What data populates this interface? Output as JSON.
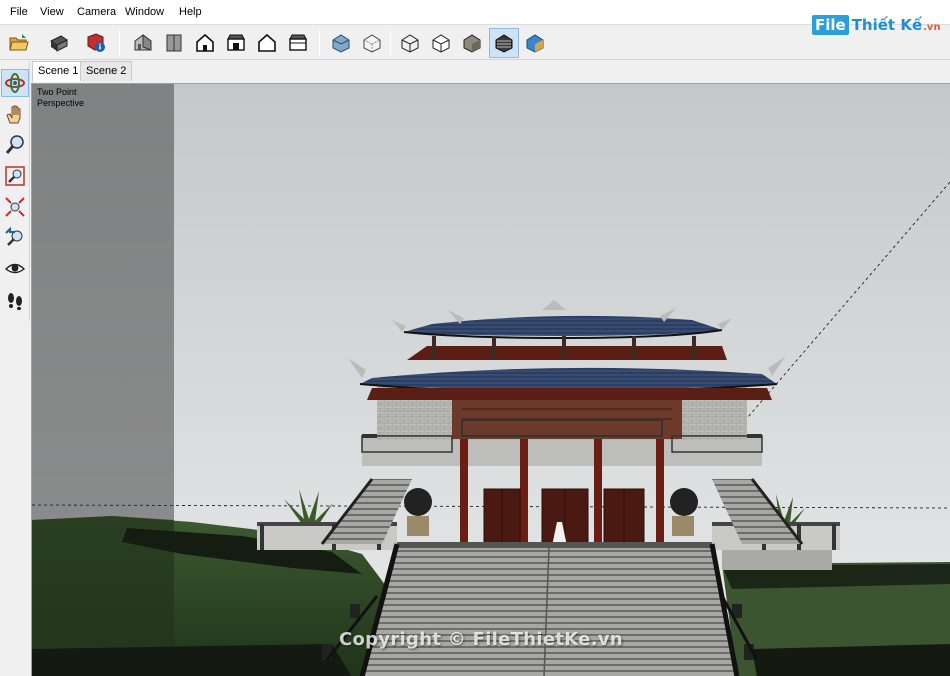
{
  "menu": {
    "items": [
      "File",
      "View",
      "Camera",
      "Window",
      "Help"
    ]
  },
  "logo": {
    "box_text": "File",
    "text": "Thiết Kế",
    "suffix": ".vn",
    "colors": {
      "box": "#2a9fd8",
      "text": "#1f8fd0",
      "suffix": "#e35b2d"
    }
  },
  "toolbar": {
    "groups": [
      [
        "open-icon",
        "print-icon",
        "model-info-icon"
      ],
      [
        "iso-view-icon",
        "top-view-icon",
        "front-view-icon",
        "right-view-icon",
        "back-view-icon",
        "left-view-icon"
      ],
      [
        "xray-style-icon",
        "back-edges-style-icon",
        "wireframe-style-icon",
        "hidden-line-style-icon",
        "shaded-style-icon",
        "shaded-textures-style-icon",
        "monochrome-style-icon"
      ]
    ],
    "active": "shaded-textures-style-icon"
  },
  "left_tools": {
    "items": [
      "orbit-icon",
      "pan-icon",
      "zoom-icon",
      "zoom-window-icon",
      "zoom-extents-icon",
      "previous-view-icon",
      "look-around-icon",
      "walk-icon"
    ],
    "active": "orbit-icon"
  },
  "scenes": {
    "tabs": [
      {
        "label": "Scene 1",
        "active": true
      },
      {
        "label": "Scene 2",
        "active": false
      }
    ]
  },
  "viewport": {
    "camera_line1": "Two Point",
    "camera_line2": "Perspective",
    "watermark": "Copyright © FileThietKe.vn",
    "colors": {
      "sky_top": "#c7cacb",
      "sky_bottom": "#e6e8e9",
      "roof": "#2c3f63",
      "timber": "#5a1e14",
      "grass": "#2f4a26"
    }
  }
}
